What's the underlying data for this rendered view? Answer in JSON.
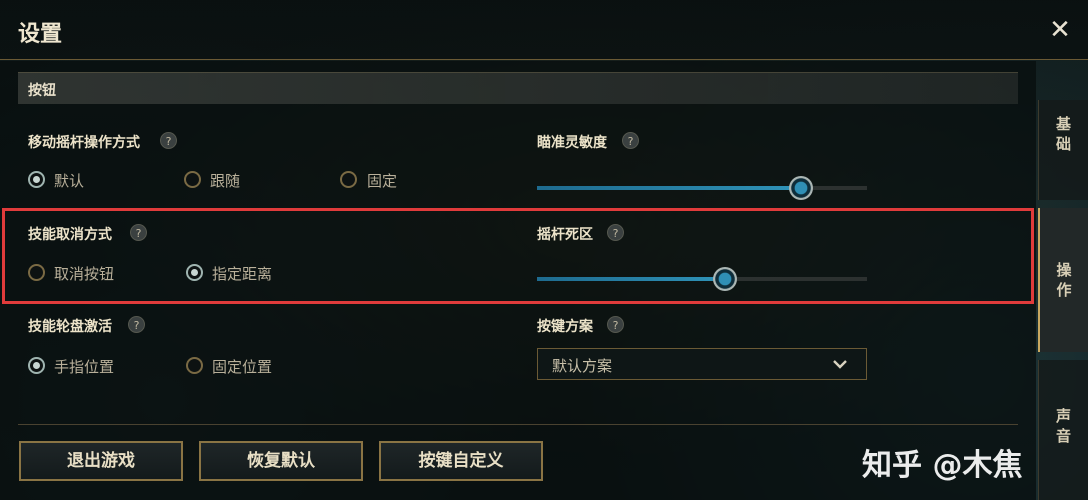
{
  "window": {
    "title": "设置",
    "close_icon": "close-icon"
  },
  "section": {
    "title": "按钮"
  },
  "settings": {
    "joystick_mode": {
      "label": "移动摇杆操作方式",
      "options": [
        "默认",
        "跟随",
        "固定"
      ],
      "selected": "默认"
    },
    "aim_sensitivity": {
      "label": "瞄准灵敏度",
      "value": 0.8
    },
    "skill_cancel": {
      "label": "技能取消方式",
      "options": [
        "取消按钮",
        "指定距离"
      ],
      "selected": "指定距离"
    },
    "joystick_deadzone": {
      "label": "摇杆死区",
      "value": 0.57
    },
    "skill_wheel": {
      "label": "技能轮盘激活",
      "options": [
        "手指位置",
        "固定位置"
      ],
      "selected": "手指位置"
    },
    "key_scheme": {
      "label": "按键方案",
      "value": "默认方案"
    }
  },
  "buttons": {
    "exit_game": "退出游戏",
    "restore_default": "恢复默认",
    "custom_keys": "按键自定义"
  },
  "side_tabs": [
    "基础",
    "操作",
    "声音"
  ],
  "help_glyph": "?",
  "watermark": "知乎 @木焦",
  "colors": {
    "accent_gold": "#8a7444",
    "highlight_red": "#e03b3b",
    "slider_blue": "#2f93b8"
  }
}
